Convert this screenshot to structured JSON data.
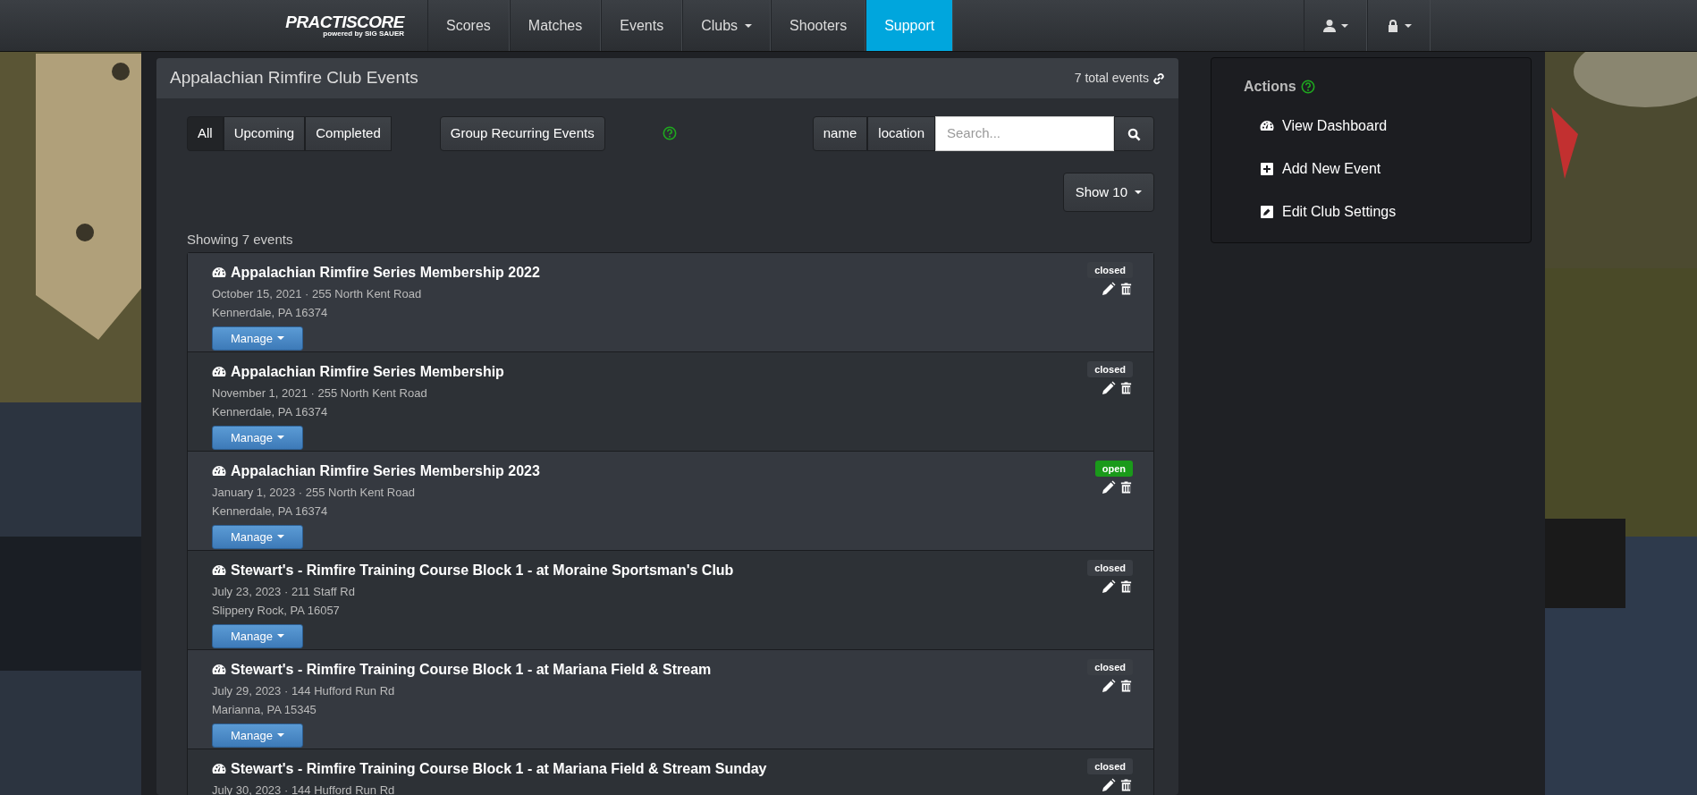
{
  "navbar": {
    "brand": {
      "name": "PRACTISCORE",
      "tagline_prefix": "powered by",
      "tagline_brand": "SIG SAUER"
    },
    "items": [
      {
        "label": "Scores",
        "dropdown": false,
        "selected": false
      },
      {
        "label": "Matches",
        "dropdown": false,
        "selected": false
      },
      {
        "label": "Events",
        "dropdown": false,
        "selected": false
      },
      {
        "label": "Clubs",
        "dropdown": true,
        "selected": false
      },
      {
        "label": "Shooters",
        "dropdown": false,
        "selected": false
      },
      {
        "label": "Support",
        "dropdown": false,
        "selected": true
      }
    ],
    "right_menus": [
      {
        "kind": "user"
      },
      {
        "kind": "lock"
      }
    ]
  },
  "panel": {
    "title": "Appalachian Rimfire Club Events",
    "total": "7 total events",
    "filters": [
      {
        "label": "All",
        "selected": true
      },
      {
        "label": "Upcoming",
        "selected": false
      },
      {
        "label": "Completed",
        "selected": false
      }
    ],
    "group_button": "Group Recurring Events",
    "search_fields": [
      {
        "label": "name"
      },
      {
        "label": "location"
      }
    ],
    "search": {
      "placeholder": "Search..."
    },
    "page_size": "Show 10",
    "showing": "Showing 7 events",
    "events": [
      {
        "title": "Appalachian Rimfire Series Membership 2022",
        "date_address": "October 15, 2021 · 255 North Kent Road",
        "city": "Kennerdale, PA 16374",
        "manage": "Manage",
        "status": "closed"
      },
      {
        "title": "Appalachian Rimfire Series Membership",
        "date_address": "November 1, 2021 · 255 North Kent Road",
        "city": "Kennerdale, PA 16374",
        "manage": "Manage",
        "status": "closed"
      },
      {
        "title": "Appalachian Rimfire Series Membership 2023",
        "date_address": "January 1, 2023 · 255 North Kent Road",
        "city": "Kennerdale, PA 16374",
        "manage": "Manage",
        "status": "open"
      },
      {
        "title": "Stewart's - Rimfire Training Course Block 1 - at Moraine Sportsman's Club",
        "date_address": "July 23, 2023 · 211 Staff Rd",
        "city": "Slippery Rock, PA 16057",
        "manage": "Manage",
        "status": "closed"
      },
      {
        "title": "Stewart's - Rimfire Training Course Block 1 - at Mariana Field & Stream",
        "date_address": "July 29, 2023 · 144 Hufford Run Rd",
        "city": "Marianna, PA 15345",
        "manage": "Manage",
        "status": "closed"
      },
      {
        "title": "Stewart's - Rimfire Training Course Block 1 - at Mariana Field & Stream Sunday",
        "date_address": "July 30, 2023 · 144 Hufford Run Rd",
        "status": "closed"
      }
    ]
  },
  "actions": {
    "title": "Actions",
    "items": [
      {
        "label": "View Dashboard",
        "kind": "dashboard"
      },
      {
        "label": "Add New Event",
        "kind": "add"
      },
      {
        "label": "Edit Club Settings",
        "kind": "edit"
      }
    ]
  }
}
